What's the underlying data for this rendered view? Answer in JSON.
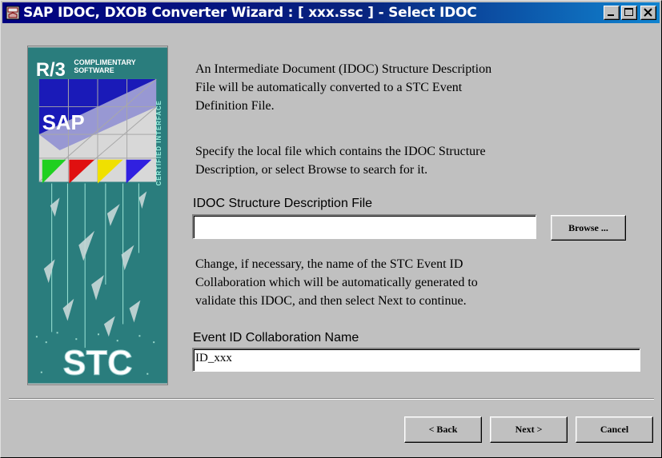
{
  "window": {
    "title": "SAP IDOC, DXOB Converter Wizard : [ xxx.ssc ] - Select IDOC",
    "icons": [
      "app-icon",
      "minimize-icon",
      "maximize-icon",
      "close-icon"
    ]
  },
  "logo": {
    "line1": "R/3",
    "line2a": "COMPLIMENTARY",
    "line2b": "SOFTWARE",
    "vertical": "CERTIFIED INTERFACE",
    "brand": "SAP",
    "footer": "STC",
    "colors": {
      "blue": "#1010c0",
      "green": "#20d020",
      "red": "#e01010",
      "yellow": "#f0e000",
      "violet": "#3020e0",
      "teal": "#2a7d7d"
    }
  },
  "intro": {
    "line1": "An Intermediate Document (IDOC) Structure Description",
    "line2": "File will be automatically converted to a STC Event",
    "line3": "Definition File."
  },
  "specify": {
    "line1": "Specify the local file which contains the IDOC Structure",
    "line2": "Description, or select Browse to search for it."
  },
  "idoc_file": {
    "label": "IDOC Structure Description File",
    "value": "",
    "browse_label": "Browse ..."
  },
  "change": {
    "line1": "Change, if necessary, the name of the STC Event ID",
    "line2": "Collaboration which will be automatically generated to",
    "line3": "validate this IDOC, and then select Next to continue."
  },
  "collab": {
    "label": "Event ID Collaboration Name",
    "value": "ID_xxx"
  },
  "buttons": {
    "back": "< Back",
    "next": "Next >",
    "cancel": "Cancel"
  }
}
